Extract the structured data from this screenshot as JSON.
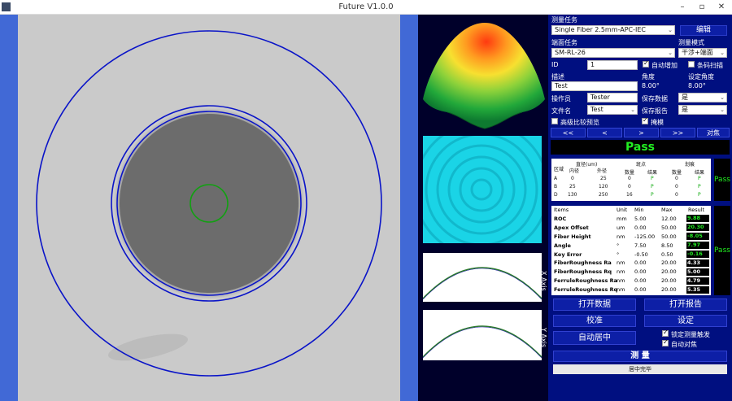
{
  "window": {
    "title": "Future V1.0.0",
    "minimize": "–",
    "maximize": "▫",
    "close": "✕"
  },
  "axes": {
    "x_label": "X Axis",
    "y_label": "Y Axis"
  },
  "form": {
    "measure_task_label": "测量任务",
    "measure_task_value": "Single Fiber 2.5mm-APC-IEC",
    "edit_button": "编辑",
    "endface_task_label": "端面任务",
    "measure_mode_label": "测量模式",
    "endface_task_value": "SM-RL-26",
    "measure_mode_value": "干涉+端面",
    "id_label": "ID",
    "id_value": "1",
    "auto_increment_label": "自动增加",
    "barcode_scan_label": "条码扫描",
    "desc_label": "描述",
    "angle_label": "角度",
    "set_angle_label": "设定角度",
    "desc_value": "Test",
    "angle_value": "8.00°",
    "set_angle_value": "8.00°",
    "operator_label": "操作员",
    "operator_value": "Tester",
    "save_data_label": "保存数据",
    "save_data_value": "是",
    "filename_label": "文件名",
    "filename_value": "Test",
    "save_report_label": "保存报告",
    "save_report_value": "是",
    "hires_preview_label": "高级比较预览",
    "mask_label": "掩模"
  },
  "nav": {
    "first": "<<",
    "prev": "<",
    "next": ">",
    "last": ">>",
    "focus": "对焦"
  },
  "result_pass": "Pass",
  "zone_table": {
    "h_zone": "区域",
    "h_diameter": "直径(um)",
    "h_inner": "内径",
    "h_outer": "外径",
    "h_spots": "斑点",
    "h_scratches": "划痕",
    "h_count": "数量",
    "h_result": "结果",
    "rows": [
      {
        "zone": "A",
        "inner": "0",
        "outer": "25",
        "spots": "0",
        "spot_res": "P",
        "scr": "0",
        "scr_res": "P"
      },
      {
        "zone": "B",
        "inner": "25",
        "outer": "120",
        "spots": "0",
        "spot_res": "P",
        "scr": "0",
        "scr_res": "P"
      },
      {
        "zone": "D",
        "inner": "130",
        "outer": "250",
        "spots": "16",
        "spot_res": "P",
        "scr": "0",
        "scr_res": "P"
      }
    ],
    "side_result": "Pass"
  },
  "measure_table": {
    "h_items": "Items",
    "h_unit": "Unit",
    "h_min": "Min",
    "h_max": "Max",
    "h_result": "Result",
    "rows": [
      {
        "item": "ROC",
        "unit": "mm",
        "min": "5.00",
        "max": "12.00",
        "result": "9.88"
      },
      {
        "item": "Apex Offset",
        "unit": "um",
        "min": "0.00",
        "max": "50.00",
        "result": "20.30"
      },
      {
        "item": "Fiber Height",
        "unit": "nm",
        "min": "-125.00",
        "max": "50.00",
        "result": "-8.05"
      },
      {
        "item": "Angle",
        "unit": "°",
        "min": "7.50",
        "max": "8.50",
        "result": "7.97"
      },
      {
        "item": "Key Error",
        "unit": "°",
        "min": "-0.50",
        "max": "0.50",
        "result": "-0.16"
      },
      {
        "item": "FiberRoughness Ra",
        "unit": "nm",
        "min": "0.00",
        "max": "20.00",
        "result": "4.33"
      },
      {
        "item": "FiberRoughness Rq",
        "unit": "nm",
        "min": "0.00",
        "max": "20.00",
        "result": "5.00"
      },
      {
        "item": "FerruleRoughness Ra",
        "unit": "nm",
        "min": "0.00",
        "max": "20.00",
        "result": "4.79"
      },
      {
        "item": "FerruleRoughness Rq",
        "unit": "nm",
        "min": "0.00",
        "max": "20.00",
        "result": "5.35"
      }
    ],
    "side_result": "Pass",
    "pass_color": "#22ee22",
    "white_color": "#ffffff"
  },
  "actions": {
    "open_data": "打开数据",
    "open_report": "打开报告",
    "calibrate": "校准",
    "settings": "设定",
    "auto_center": "自动居中",
    "lock_trigger": "锁定测量触发",
    "auto_focus": "自动对焦",
    "measure": "测 量",
    "status": "居中完毕"
  }
}
